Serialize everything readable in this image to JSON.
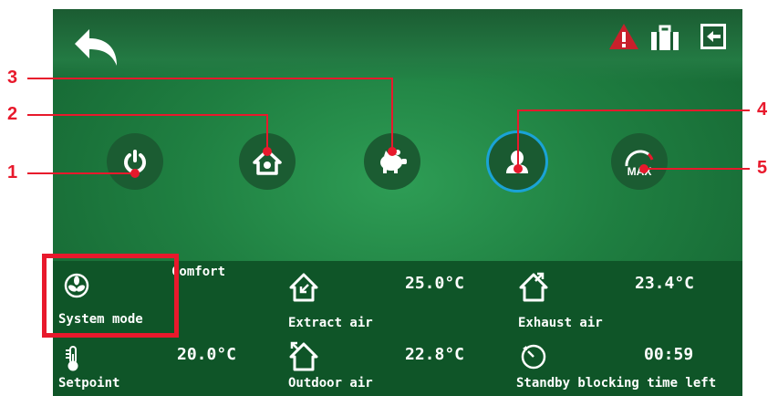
{
  "header": {
    "back_icon": "back-arrow-icon",
    "alarm_icon": "warning-triangle-icon",
    "service_icon": "briefcase-icon",
    "exit_icon": "exit-door-icon"
  },
  "modes": [
    {
      "id": "off",
      "icon": "power-icon",
      "active": false
    },
    {
      "id": "home",
      "icon": "home-icon",
      "active": false
    },
    {
      "id": "economy",
      "icon": "piggy-bank-icon",
      "active": false
    },
    {
      "id": "comfort",
      "icon": "person-icon",
      "active": true
    },
    {
      "id": "max",
      "icon": "max-gauge-icon",
      "label": "MAX",
      "active": false
    }
  ],
  "callouts": [
    "1",
    "2",
    "3",
    "4",
    "5"
  ],
  "status": {
    "system_mode": {
      "label": "System mode",
      "value": "Comfort",
      "icon": "fan-icon"
    },
    "extract_air": {
      "label": "Extract air",
      "value": "25.0°C",
      "icon": "house-extract-icon"
    },
    "exhaust_air": {
      "label": "Exhaust air",
      "value": "23.4°C",
      "icon": "house-exhaust-icon"
    },
    "setpoint": {
      "label": "Setpoint",
      "value": "20.0°C",
      "icon": "thermometer-icon"
    },
    "outdoor_air": {
      "label": "Outdoor air",
      "value": "22.8°C",
      "icon": "house-outdoor-icon"
    },
    "standby": {
      "label": "Standby blocking time left",
      "value": "00:59",
      "icon": "timer-icon"
    }
  },
  "colors": {
    "accent_red": "#e8192c",
    "active_ring": "#1aa3d6",
    "screen_green": "#1f7f41"
  }
}
